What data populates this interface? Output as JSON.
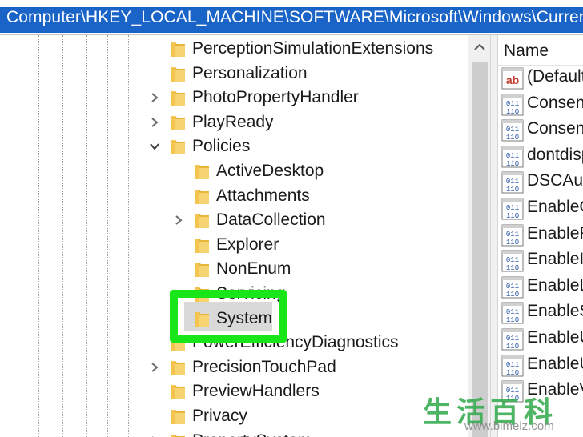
{
  "address_bar": {
    "path": "Computer\\HKEY_LOCAL_MACHINE\\SOFTWARE\\Microsoft\\Windows\\CurrentVersion\\Policies\\System"
  },
  "tree": {
    "items": [
      {
        "label": "PerceptionSimulationExtensions",
        "expander": "none"
      },
      {
        "label": "Personalization",
        "expander": "none"
      },
      {
        "label": "PhotoPropertyHandler",
        "expander": "collapsed"
      },
      {
        "label": "PlayReady",
        "expander": "collapsed"
      },
      {
        "label": "Policies",
        "expander": "expanded"
      },
      {
        "label": "ActiveDesktop",
        "expander": "none"
      },
      {
        "label": "Attachments",
        "expander": "none"
      },
      {
        "label": "DataCollection",
        "expander": "collapsed"
      },
      {
        "label": "Explorer",
        "expander": "none"
      },
      {
        "label": "NonEnum",
        "expander": "none"
      },
      {
        "label": "Servicing",
        "expander": "none"
      },
      {
        "label": "System",
        "expander": "none",
        "selected": true
      },
      {
        "label": "PowerEfficiencyDiagnostics",
        "expander": "none"
      },
      {
        "label": "PrecisionTouchPad",
        "expander": "collapsed"
      },
      {
        "label": "PreviewHandlers",
        "expander": "none"
      },
      {
        "label": "Privacy",
        "expander": "none"
      },
      {
        "label": "PropertySystem",
        "expander": "collapsed"
      }
    ]
  },
  "values_list": {
    "column_header": "Name",
    "items": [
      {
        "name": "(Default)",
        "icon": "string-value-icon"
      },
      {
        "name": "ConsentPromptBehaviorAdmin",
        "icon": "binary-value-icon"
      },
      {
        "name": "ConsentPromptBehaviorUser",
        "icon": "binary-value-icon"
      },
      {
        "name": "dontdisplaylastusername",
        "icon": "binary-value-icon"
      },
      {
        "name": "DSCAutomationHostEnabled",
        "icon": "binary-value-icon"
      },
      {
        "name": "EnableCursorSuppression",
        "icon": "binary-value-icon"
      },
      {
        "name": "EnableFullTrustStartupTasks",
        "icon": "binary-value-icon"
      },
      {
        "name": "EnableInstallerDetection",
        "icon": "binary-value-icon"
      },
      {
        "name": "EnableLUA",
        "icon": "binary-value-icon"
      },
      {
        "name": "EnableSecureUIAPaths",
        "icon": "binary-value-icon"
      },
      {
        "name": "EnableUIADesktopToggle",
        "icon": "binary-value-icon"
      },
      {
        "name": "EnableUwpStartupTasks",
        "icon": "binary-value-icon"
      },
      {
        "name": "EnableVirtualization",
        "icon": "binary-value-icon"
      }
    ]
  },
  "watermark": {
    "text": "生活百科",
    "url": "www.bimeiz.com"
  },
  "colors": {
    "highlight_box": "#19e619",
    "address_selection": "#1a64c8",
    "folder_yellow": "#f3c44e",
    "watermark_green": "#2fa94a"
  }
}
